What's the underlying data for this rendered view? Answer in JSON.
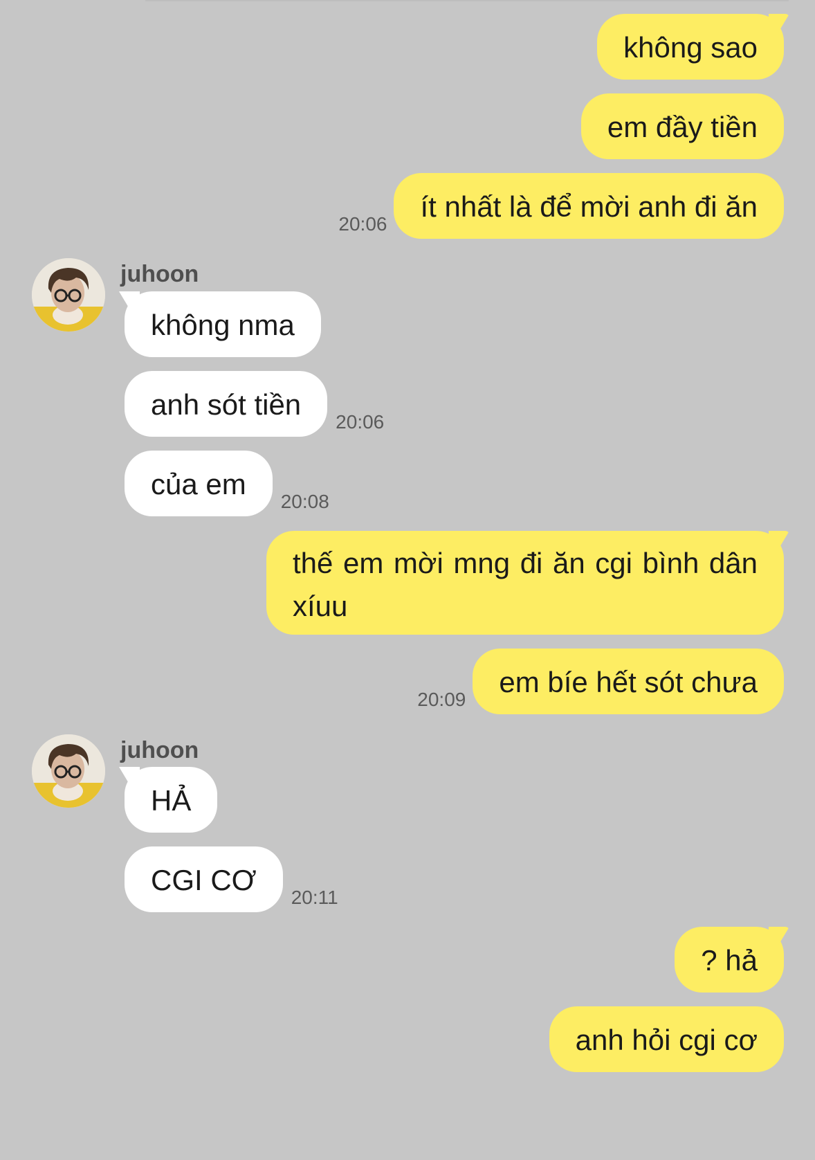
{
  "conversation": {
    "contact_name": "juhoon",
    "messages": [
      {
        "side": "out",
        "text": "không sao",
        "time": ""
      },
      {
        "side": "out",
        "text": "em đầy tiền",
        "time": ""
      },
      {
        "side": "out",
        "text": "ít nhất là để mời anh đi ăn",
        "time": "20:06"
      },
      {
        "side": "in",
        "sender": "juhoon",
        "text": "không nma",
        "time": ""
      },
      {
        "side": "in",
        "text": "anh sót tiền",
        "time": "20:06"
      },
      {
        "side": "in",
        "text": "của em",
        "time": "20:08"
      },
      {
        "side": "out",
        "text": "thế em mời mng đi ăn cgi bình dân xíuu",
        "time": ""
      },
      {
        "side": "out",
        "text": "em bíe hết sót chưa",
        "time": "20:09"
      },
      {
        "side": "in",
        "sender": "juhoon",
        "text": "HẢ",
        "time": ""
      },
      {
        "side": "in",
        "text": "CGI CƠ",
        "time": "20:11"
      },
      {
        "side": "out",
        "text": "? hả",
        "time": ""
      },
      {
        "side": "out",
        "text": "anh hỏi cgi cơ",
        "time": ""
      }
    ]
  },
  "colors": {
    "background": "#c6c6c6",
    "outgoing_bubble": "#fded63",
    "incoming_bubble": "#ffffff",
    "timestamp": "#5a5a5a",
    "sender_name": "#4f4f4f"
  },
  "icons": {
    "avatar": "profile-photo"
  }
}
